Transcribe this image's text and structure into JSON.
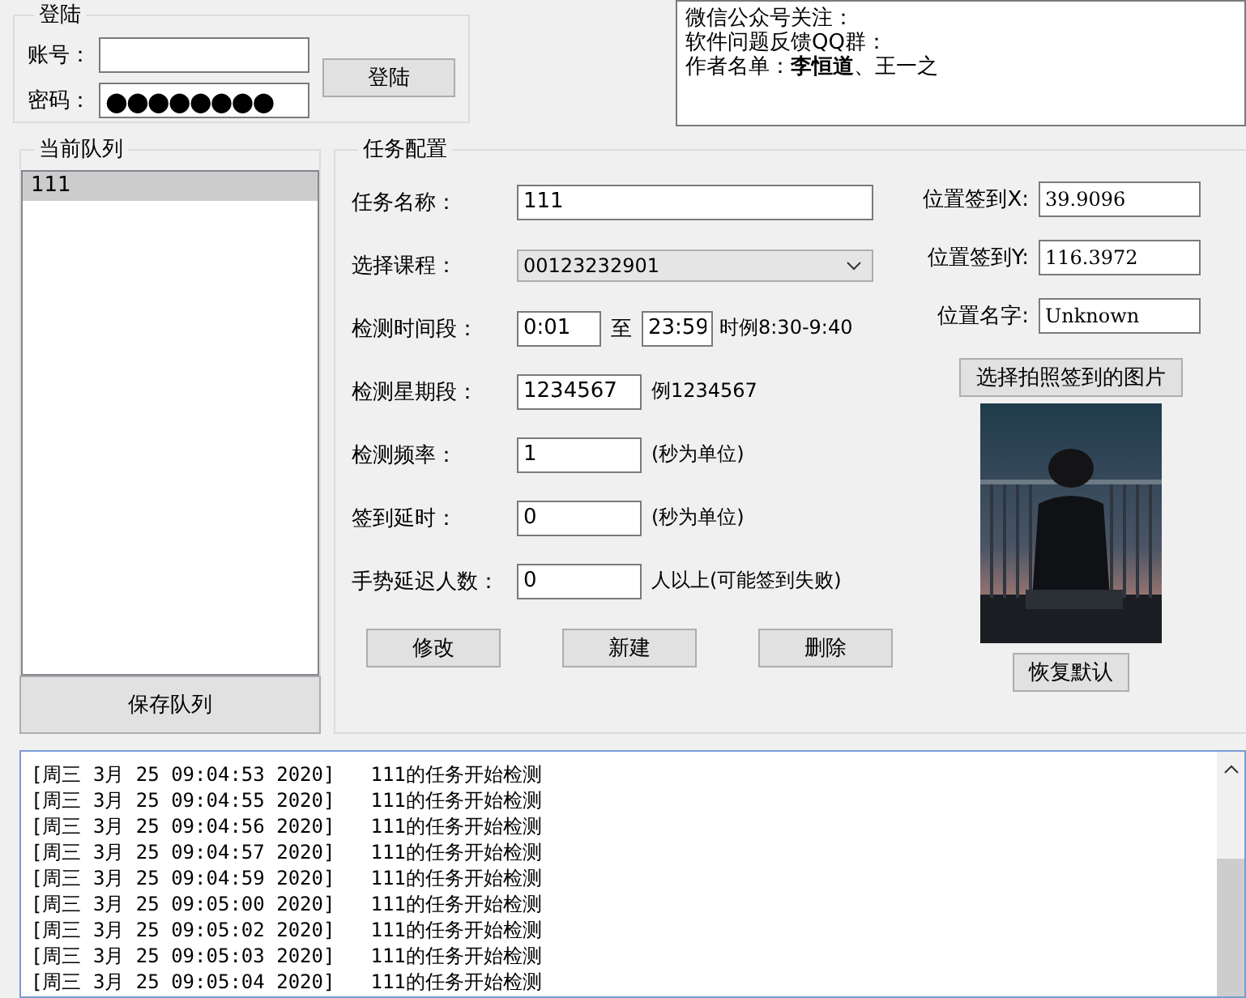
{
  "login": {
    "title": "登陆",
    "fields": [
      {
        "kind": "text",
        "label": "账号："
      },
      {
        "kind": "password",
        "label": "密码：",
        "value": "●●●●●●●●"
      }
    ],
    "button": "登陆"
  },
  "info": {
    "lines": [
      "微信公众号关注：",
      "软件问题反馈QQ群：",
      "作者名单：**李恒道**、王一之"
    ]
  },
  "queue": {
    "title": "当前队列",
    "items": [
      {
        "label": "111",
        "selected": true
      }
    ],
    "save_button": "保存队列"
  },
  "config": {
    "title": "任务配置",
    "fields": [
      {
        "kind": "text",
        "label": "任务名称：",
        "value": "111"
      },
      {
        "kind": "select",
        "label": "选择课程：",
        "value": "00123232901"
      },
      {
        "kind": "range",
        "label": "检测时间段：",
        "from": "0:01",
        "separator": "至",
        "to": "23:59",
        "hint": "时例8:30-9:40"
      },
      {
        "kind": "short",
        "label": "检测星期段：",
        "value": "1234567",
        "hint": "例1234567"
      },
      {
        "kind": "short",
        "label": "检测频率：",
        "value": "1",
        "hint": "(秒为单位)"
      },
      {
        "kind": "short",
        "label": "签到延时：",
        "value": "0",
        "hint": "(秒为单位)"
      },
      {
        "kind": "short",
        "label": "手势延迟人数：",
        "value": "0",
        "hint": "人以上(可能签到失败)"
      }
    ],
    "buttons": [
      "修改",
      "新建",
      "删除"
    ],
    "location": [
      {
        "label": "位置签到X:",
        "value": "39.9096"
      },
      {
        "label": "位置签到Y:",
        "value": "116.3972"
      },
      {
        "label": "位置名字:",
        "value": "Unknown"
      }
    ],
    "photo_button": "选择拍照签到的图片",
    "reset_button": "恢复默认"
  },
  "log": {
    "lines": [
      {
        "time": "[周三 3月 25 09:04:53 2020]",
        "message": "111的任务开始检测"
      },
      {
        "time": "[周三 3月 25 09:04:55 2020]",
        "message": "111的任务开始检测"
      },
      {
        "time": "[周三 3月 25 09:04:56 2020]",
        "message": "111的任务开始检测"
      },
      {
        "time": "[周三 3月 25 09:04:57 2020]",
        "message": "111的任务开始检测"
      },
      {
        "time": "[周三 3月 25 09:04:59 2020]",
        "message": "111的任务开始检测"
      },
      {
        "time": "[周三 3月 25 09:05:00 2020]",
        "message": "111的任务开始检测"
      },
      {
        "time": "[周三 3月 25 09:05:02 2020]",
        "message": "111的任务开始检测"
      },
      {
        "time": "[周三 3月 25 09:05:03 2020]",
        "message": "111的任务开始检测"
      },
      {
        "time": "[周三 3月 25 09:05:04 2020]",
        "message": "111的任务开始检测"
      }
    ]
  }
}
